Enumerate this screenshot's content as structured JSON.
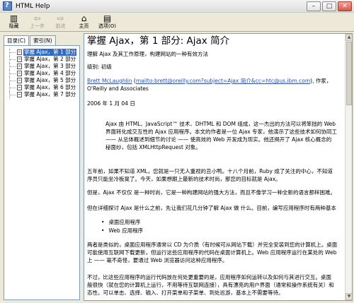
{
  "window": {
    "title": "HTML Help",
    "controls": {
      "minimize": "–",
      "maximize": "□",
      "close": "✕"
    }
  },
  "toolbar": {
    "buttons": [
      {
        "label": "隐藏",
        "icon": "hide-icon",
        "glyph": "▥",
        "enabled": true
      },
      {
        "label": "上一步",
        "icon": "back-arrow-icon",
        "glyph": "⇦",
        "enabled": false
      },
      {
        "label": "前进",
        "icon": "forward-arrow-icon",
        "glyph": "⇨",
        "enabled": false
      },
      {
        "label": "主页",
        "icon": "home-icon",
        "glyph": "⌂",
        "enabled": true
      },
      {
        "label": "选项(O)",
        "icon": "options-icon",
        "glyph": "▤",
        "enabled": true
      }
    ]
  },
  "sidebar": {
    "tabs": [
      {
        "label": "目录(C)",
        "active": true
      },
      {
        "label": "索引(N)",
        "active": false
      }
    ],
    "items": [
      {
        "label": "掌握 Ajax，第 1 部分",
        "selected": true
      },
      {
        "label": "掌握 Ajax，第 2 部分",
        "selected": false
      },
      {
        "label": "掌握 Ajax，第 3 部分",
        "selected": false
      },
      {
        "label": "掌握 Ajax，第 4 部分",
        "selected": false
      },
      {
        "label": "掌握 Ajax，第 5 部分",
        "selected": false
      },
      {
        "label": "掌握 Ajax，第 6 部分",
        "selected": false
      },
      {
        "label": "掌握 Ajax，第 7 部分",
        "selected": false
      }
    ]
  },
  "article": {
    "title": "掌握 Ajax，第 1 部分: Ajax 简介",
    "subtitle": "理解 Ajax 及其工作原理，构建网站的一种有效方法",
    "level": "级别: 初级",
    "author_name": "Brett McLaughlin",
    "author_open": " (",
    "author_email": "mailto:brett@oreilly.com?subject=Ajax 简介&cc=htc@us.ibm.com",
    "author_suffix": "), 作家，",
    "publisher": "O'Reilly and Associates",
    "date": "2006 年 1 月 04 日",
    "abstract_lines": [
      "Ajax 由 HTML、JavaScript™ 技术、DHTML 和 DOM 组成，这一杰出的方法可以将笨拙的 Web",
      "界面转化成交互性的 Ajax 应用程序。本文的作者是一位 Ajax 专家，他演示了这些技术如何协同工",
      "—— 从总体概述到细节的讨论 —— 使高效的 Web 开发成为现实。他还揭开了 Ajax 核心概念的",
      "秘面纱，包括 XMLHttpRequest 对象。"
    ],
    "para1_lines": [
      "五年前，如果不知道 XML，您就是一只无人重视的丑小鸭。十八个月前，Ruby 成了关注的中心，不知道",
      "序员只能坐冷板凳了。今天，如果想跟上最新的技术时尚，那您的目标就是 Ajax。"
    ],
    "para2": "但是，Ajax 不仅仅 是一种时尚，它是一种构建网站的强大方法，而且不像学习一种全新的语言那样困难。",
    "para3": "但在详细探讨 Ajax 是什么之前，先让我们花几分钟了解 Ajax 做 什么。目前，编写应用程序时有两种基本",
    "bullets": [
      "桌面应用程序",
      "Web 应用程序"
    ],
    "para4_lines": [
      "两者是类似的，桌面应用程序通常以 CD 为介质（有时候可从网站下载）并完全安装到您的计算机上。桌面",
      "可能使用互联网下载更新，但运行这些应用程序的代码在桌面计算机上。Web 应用程序运行在某处的 Web",
      "上 —— 毫不奇怪，要通过 Web 浏览器访问这种应用程序。"
    ],
    "para5_lines": [
      "不过，比这些应用程序的运行代码放在何处更重要的是，应用程序如何运转以及如何与其进行交互。桌面",
      "般很快（就在您的计算机上运行，不用等待互联网连接），具有漂亮的用户界面（通常和操作系统有关）和",
      "态性。可以单击、选择、输入、打开菜单和子菜单、到处巡游，基本上不需要等待。"
    ]
  }
}
